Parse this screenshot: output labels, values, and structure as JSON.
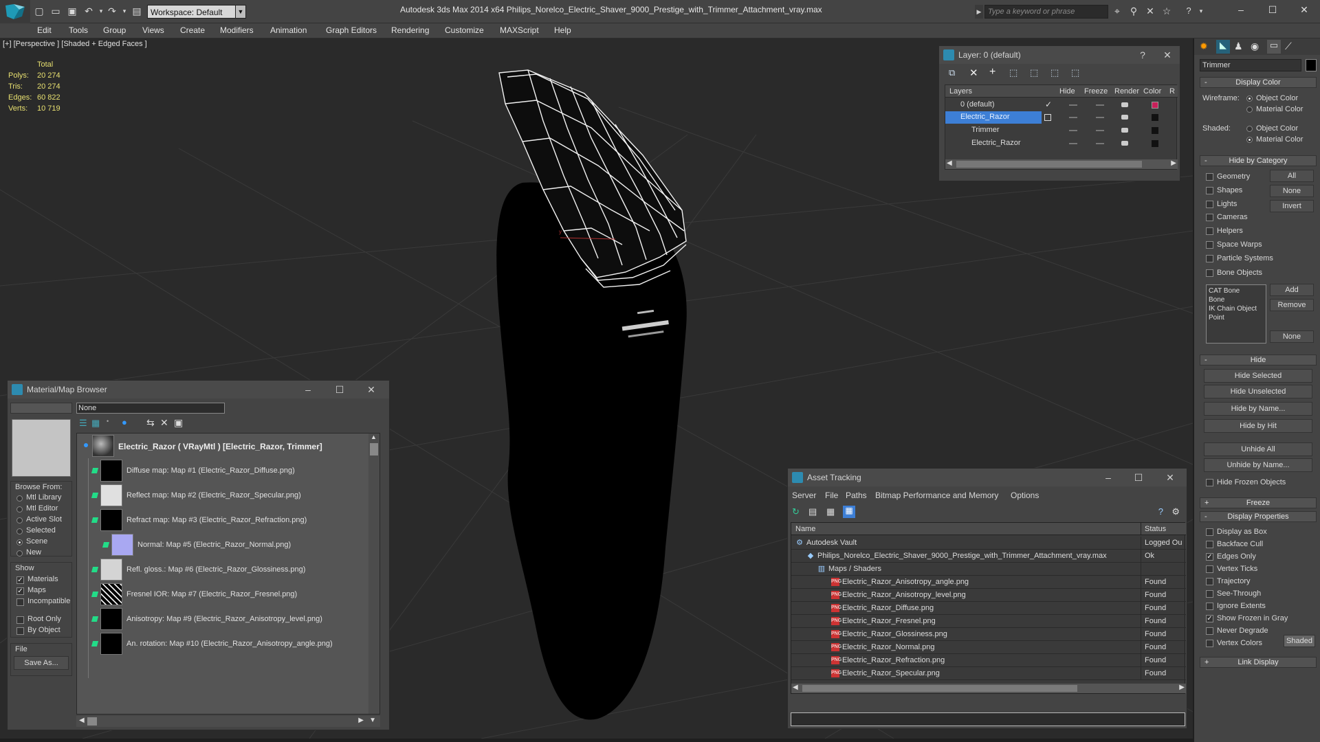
{
  "titlebar": {
    "workspace": "Workspace: Default",
    "app_title": "Autodesk 3ds Max  2014 x64      Philips_Norelco_Electric_Shaver_9000_Prestige_with_Trimmer_Attachment_vray.max",
    "search_placeholder": "Type a keyword or phrase"
  },
  "menu": [
    "Edit",
    "Tools",
    "Group",
    "Views",
    "Create",
    "Modifiers",
    "Animation",
    "Graph Editors",
    "Rendering",
    "Customize",
    "MAXScript",
    "Help"
  ],
  "viewport": {
    "label": "[+] [Perspective ] [Shaded + Edged Faces ]",
    "stats": {
      "header": "Total",
      "rows": [
        {
          "label": "Polys:",
          "value": "20 274"
        },
        {
          "label": "Tris:",
          "value": "20 274"
        },
        {
          "label": "Edges:",
          "value": "60 822"
        },
        {
          "label": "Verts:",
          "value": "10 719"
        }
      ]
    }
  },
  "layer_panel": {
    "title": "Layer: 0 (default)",
    "columns": [
      "Layers",
      "Hide",
      "Freeze",
      "Render",
      "Color",
      "R"
    ],
    "rows": [
      {
        "name": "0 (default)",
        "color": "#c8205a"
      },
      {
        "name": "Electric_Razor",
        "color": "#111111"
      },
      {
        "name": "Trimmer",
        "color": "#111111"
      },
      {
        "name": "Electric_Razor",
        "color": "#111111"
      }
    ]
  },
  "material_browser": {
    "title": "Material/Map Browser",
    "search_value": "None",
    "browse_from_label": "Browse From:",
    "browse_from": [
      "Mtl Library",
      "Mtl Editor",
      "Active Slot",
      "Selected",
      "Scene",
      "New"
    ],
    "show_label": "Show",
    "show": [
      "Materials",
      "Maps",
      "Incompatible"
    ],
    "root_only": "Root Only",
    "by_object": "By Object",
    "file_label": "File",
    "save_as": "Save As...",
    "root_item": "Electric_Razor  ( VRayMtl )  [Electric_Razor, Trimmer]",
    "items": [
      "Diffuse map: Map #1 (Electric_Razor_Diffuse.png)",
      "Reflect map: Map #2 (Electric_Razor_Specular.png)",
      "Refract map: Map #3 (Electric_Razor_Refraction.png)",
      "Normal: Map #5 (Electric_Razor_Normal.png)",
      "Refl. gloss.: Map #6 (Electric_Razor_Glossiness.png)",
      "Fresnel IOR: Map #7 (Electric_Razor_Fresnel.png)",
      "Anisotropy: Map #9 (Electric_Razor_Anisotropy_level.png)",
      "An. rotation: Map #10 (Electric_Razor_Anisotropy_angle.png)"
    ]
  },
  "asset_tracking": {
    "title": "Asset Tracking",
    "menu": [
      "Server",
      "File",
      "Paths",
      "Bitmap Performance and Memory",
      "Options"
    ],
    "columns": [
      "Name",
      "Status"
    ],
    "rows": [
      {
        "name": "Autodesk Vault",
        "status": "Logged Ou"
      },
      {
        "name": "Philips_Norelco_Electric_Shaver_9000_Prestige_with_Trimmer_Attachment_vray.max",
        "status": "Ok"
      },
      {
        "name": "Maps / Shaders",
        "status": ""
      },
      {
        "name": "Electric_Razor_Anisotropy_angle.png",
        "status": "Found"
      },
      {
        "name": "Electric_Razor_Anisotropy_level.png",
        "status": "Found"
      },
      {
        "name": "Electric_Razor_Diffuse.png",
        "status": "Found"
      },
      {
        "name": "Electric_Razor_Fresnel.png",
        "status": "Found"
      },
      {
        "name": "Electric_Razor_Glossiness.png",
        "status": "Found"
      },
      {
        "name": "Electric_Razor_Normal.png",
        "status": "Found"
      },
      {
        "name": "Electric_Razor_Refraction.png",
        "status": "Found"
      },
      {
        "name": "Electric_Razor_Specular.png",
        "status": "Found"
      }
    ]
  },
  "command_panel": {
    "object_name": "Trimmer",
    "display_color": {
      "header": "Display Color",
      "wireframe_label": "Wireframe:",
      "shaded_label": "Shaded:",
      "object_color": "Object Color",
      "material_color": "Material Color"
    },
    "hide_by_category": {
      "header": "Hide by Category",
      "items": [
        "Geometry",
        "Shapes",
        "Lights",
        "Cameras",
        "Helpers",
        "Space Warps",
        "Particle Systems",
        "Bone Objects"
      ],
      "buttons": [
        "All",
        "None",
        "Invert"
      ],
      "list": [
        "CAT Bone",
        "Bone",
        "IK Chain Object",
        "Point"
      ],
      "list_buttons": [
        "Add",
        "Remove",
        "None"
      ]
    },
    "hide": {
      "header": "Hide",
      "buttons": [
        "Hide Selected",
        "Hide Unselected",
        "Hide by Name...",
        "Hide by Hit",
        "Unhide All",
        "Unhide by Name..."
      ],
      "hide_frozen": "Hide Frozen Objects"
    },
    "freeze_header": "Freeze",
    "display_properties": {
      "header": "Display Properties",
      "items": [
        "Display as Box",
        "Backface Cull",
        "Edges Only",
        "Vertex Ticks",
        "Trajectory",
        "See-Through",
        "Ignore Extents",
        "Show Frozen in Gray",
        "Never Degrade",
        "Vertex Colors"
      ],
      "checked": [
        false,
        false,
        true,
        false,
        false,
        false,
        false,
        true,
        false,
        false
      ],
      "shaded_button": "Shaded"
    },
    "link_display_header": "Link Display"
  },
  "colors": {
    "accent": "#2d8bb0",
    "selection": "#3d7fd6",
    "stats_text": "#e8e070"
  }
}
